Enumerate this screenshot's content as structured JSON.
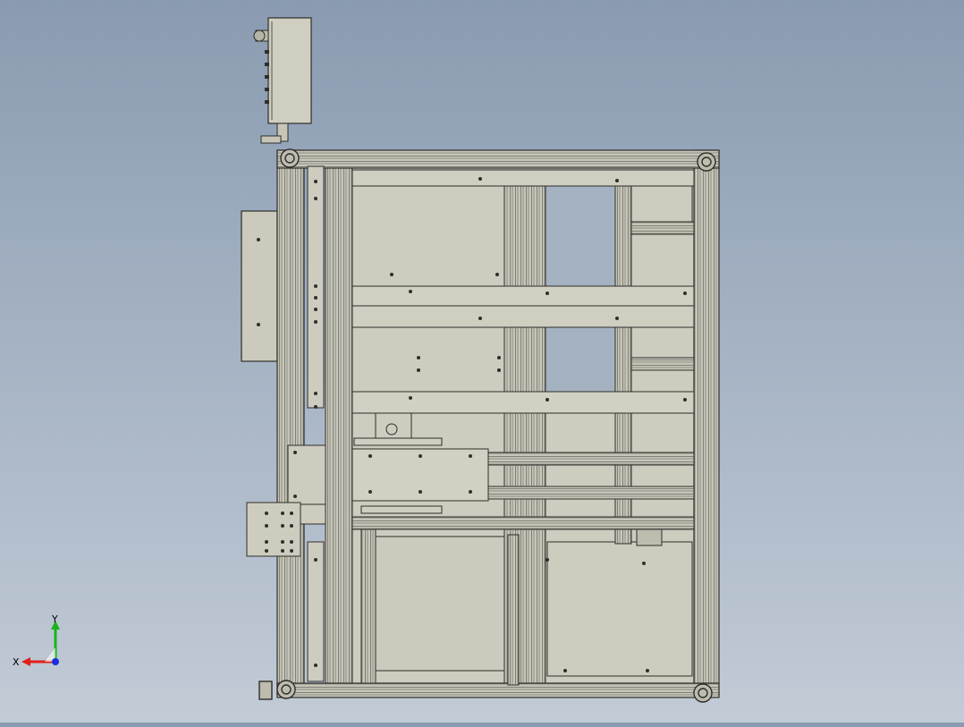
{
  "viewport": {
    "background_top": "#8a9bb1",
    "background_bottom": "#c2cbd6",
    "model_fill": "#c9c8bb",
    "model_edge": "#2e2e2a"
  },
  "triad": {
    "x_label": "X",
    "y_label": "Y",
    "x_color": "#e0201a",
    "y_color": "#19b31c",
    "z_color": "#1a2ee0"
  }
}
